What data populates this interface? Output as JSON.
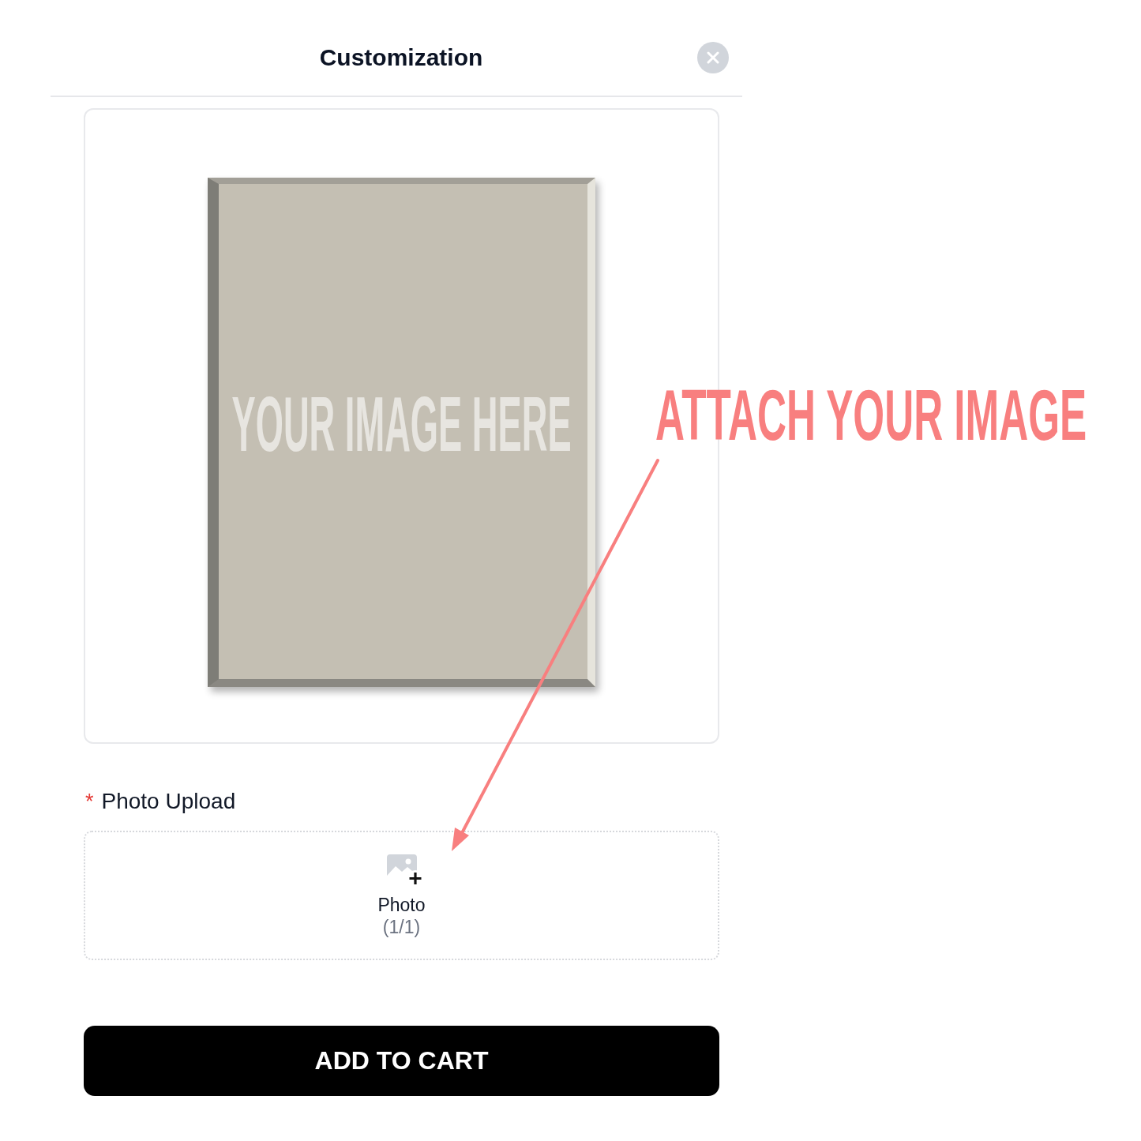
{
  "dialog": {
    "title": "Customization"
  },
  "preview": {
    "canvas_text": "YOUR IMAGE HERE"
  },
  "photo_upload": {
    "required_mark": "*",
    "label": "Photo Upload",
    "button_label": "Photo",
    "count": "(1/1)"
  },
  "add_to_cart": {
    "label": "ADD TO CART"
  },
  "annotation": {
    "text": "ATTACH YOUR IMAGE"
  }
}
